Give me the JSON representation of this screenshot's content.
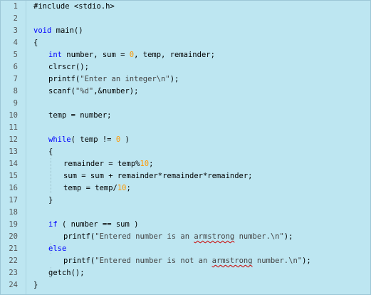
{
  "editor": {
    "lines": [
      {
        "num": "1",
        "indent": 0,
        "tokens": [
          {
            "t": "#include <stdio.h>",
            "c": "plain"
          }
        ]
      },
      {
        "num": "2",
        "indent": 0,
        "tokens": []
      },
      {
        "num": "3",
        "indent": 0,
        "tokens": [
          {
            "t": "void",
            "c": "kw"
          },
          {
            "t": " main()",
            "c": "plain"
          }
        ]
      },
      {
        "num": "4",
        "indent": 0,
        "tokens": [
          {
            "t": "{",
            "c": "plain"
          }
        ]
      },
      {
        "num": "5",
        "indent": 1,
        "tokens": [
          {
            "t": "int",
            "c": "kw"
          },
          {
            "t": " number, sum = ",
            "c": "plain"
          },
          {
            "t": "0",
            "c": "num"
          },
          {
            "t": ", temp, remainder;",
            "c": "plain"
          }
        ]
      },
      {
        "num": "6",
        "indent": 1,
        "tokens": [
          {
            "t": "clrscr();",
            "c": "plain"
          }
        ]
      },
      {
        "num": "7",
        "indent": 1,
        "tokens": [
          {
            "t": "printf(",
            "c": "plain"
          },
          {
            "t": "\"Enter an integer\\n\"",
            "c": "str"
          },
          {
            "t": ");",
            "c": "plain"
          }
        ]
      },
      {
        "num": "8",
        "indent": 1,
        "tokens": [
          {
            "t": "scanf(",
            "c": "plain"
          },
          {
            "t": "\"%d\"",
            "c": "str"
          },
          {
            "t": ",&number);",
            "c": "plain"
          }
        ]
      },
      {
        "num": "9",
        "indent": 0,
        "tokens": []
      },
      {
        "num": "10",
        "indent": 1,
        "tokens": [
          {
            "t": "temp = number;",
            "c": "plain"
          }
        ]
      },
      {
        "num": "11",
        "indent": 0,
        "tokens": []
      },
      {
        "num": "12",
        "indent": 1,
        "tokens": [
          {
            "t": "while",
            "c": "kw"
          },
          {
            "t": "( temp != ",
            "c": "plain"
          },
          {
            "t": "0",
            "c": "num"
          },
          {
            "t": " )",
            "c": "plain"
          }
        ]
      },
      {
        "num": "13",
        "indent": 1,
        "tokens": [
          {
            "t": "{",
            "c": "plain"
          }
        ]
      },
      {
        "num": "14",
        "indent": 2,
        "tokens": [
          {
            "t": "remainder = temp%",
            "c": "plain"
          },
          {
            "t": "10",
            "c": "num"
          },
          {
            "t": ";",
            "c": "plain"
          }
        ]
      },
      {
        "num": "15",
        "indent": 2,
        "tokens": [
          {
            "t": "sum = sum + remainder*remainder*remainder;",
            "c": "plain"
          }
        ]
      },
      {
        "num": "16",
        "indent": 2,
        "tokens": [
          {
            "t": "temp = temp/",
            "c": "plain"
          },
          {
            "t": "10",
            "c": "num"
          },
          {
            "t": ";",
            "c": "plain"
          }
        ]
      },
      {
        "num": "17",
        "indent": 1,
        "tokens": [
          {
            "t": "}",
            "c": "plain"
          }
        ]
      },
      {
        "num": "18",
        "indent": 0,
        "tokens": []
      },
      {
        "num": "19",
        "indent": 1,
        "tokens": [
          {
            "t": "if",
            "c": "kw"
          },
          {
            "t": " ( number == sum )",
            "c": "plain"
          }
        ]
      },
      {
        "num": "20",
        "indent": 2,
        "tokens": [
          {
            "t": "printf(",
            "c": "plain"
          },
          {
            "t": "\"Entered number is an ",
            "c": "str"
          },
          {
            "t": "armstrong",
            "c": "str-sq"
          },
          {
            "t": " number.\\n\"",
            "c": "str"
          },
          {
            "t": ");",
            "c": "plain"
          }
        ]
      },
      {
        "num": "21",
        "indent": 1,
        "tokens": [
          {
            "t": "else",
            "c": "kw"
          }
        ]
      },
      {
        "num": "22",
        "indent": 2,
        "tokens": [
          {
            "t": "printf(",
            "c": "plain"
          },
          {
            "t": "\"Entered number is not an ",
            "c": "str"
          },
          {
            "t": "armstrong",
            "c": "str-sq"
          },
          {
            "t": " number.\\n\"",
            "c": "str"
          },
          {
            "t": ");",
            "c": "plain"
          }
        ]
      },
      {
        "num": "23",
        "indent": 1,
        "tokens": [
          {
            "t": "getch();",
            "c": "plain"
          }
        ]
      },
      {
        "num": "24",
        "indent": 0,
        "tokens": [
          {
            "t": "}",
            "c": "plain"
          }
        ]
      }
    ]
  },
  "colors": {
    "background": "#bde6f1",
    "keyword": "#0000ff",
    "number_literal": "#ff9900",
    "string": "#444444",
    "line_number": "#555555"
  }
}
